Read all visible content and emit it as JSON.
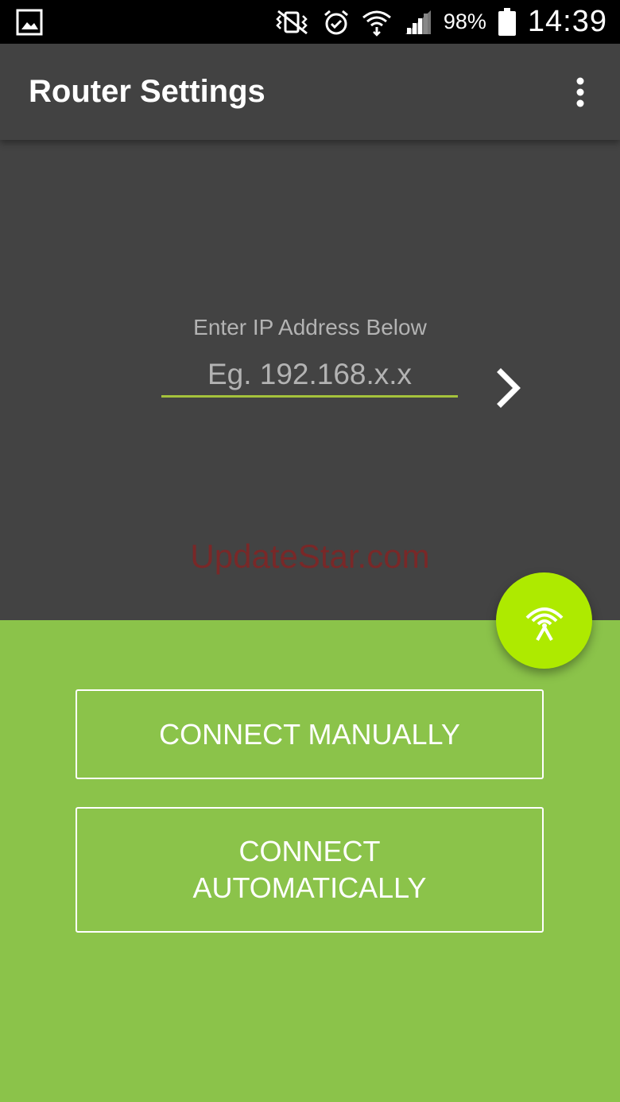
{
  "status_bar": {
    "icons": [
      "gallery-icon",
      "vibrate-icon",
      "alarm-icon",
      "wifi-icon",
      "signal-icon",
      "battery-icon"
    ],
    "battery_percent": "98%",
    "time": "14:39"
  },
  "app_bar": {
    "title": "Router Settings",
    "menu_icon": "more-vertical-icon"
  },
  "ip_entry": {
    "label": "Enter IP Address Below",
    "value": "",
    "placeholder": "Eg. 192.168.x.x",
    "go_icon": "chevron-right-icon",
    "underline_color": "#a5c23c"
  },
  "watermark": "UpdateStar.com",
  "fab": {
    "icon": "router-antenna-icon",
    "color": "#aeea00"
  },
  "actions": {
    "connect_manually": "CONNECT MANUALLY",
    "connect_automatically": "CONNECT AUTOMATICALLY"
  },
  "colors": {
    "status_bar": "#000000",
    "app_bar": "#424242",
    "dark_area": "#434343",
    "green_area": "#8bc34a"
  }
}
